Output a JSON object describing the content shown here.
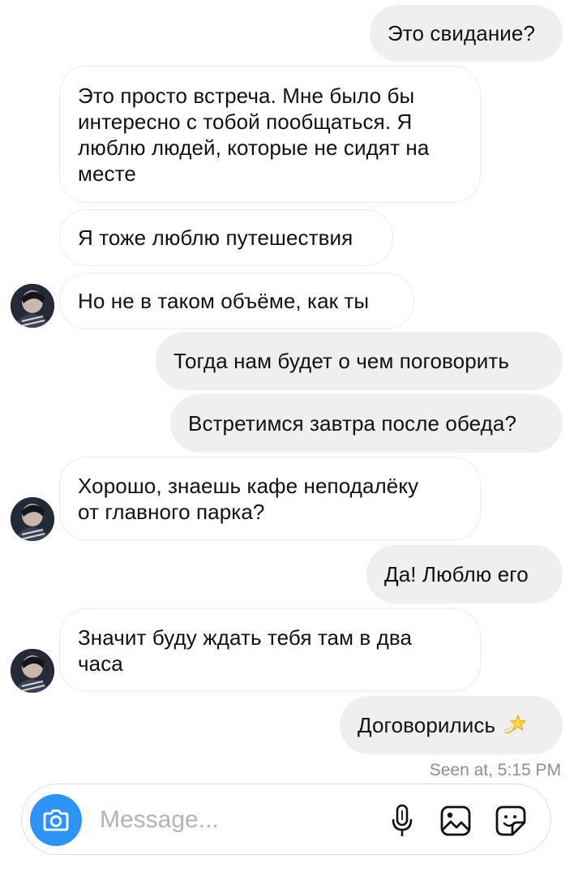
{
  "messages": [
    {
      "id": 1,
      "text": "Это свидание?",
      "direction": "outgoing"
    },
    {
      "id": 2,
      "text": "Это просто встреча. Мне было бы\nинтересно с тобой пообщаться. Я\nлюблю людей, которые не сидят на\nместе",
      "direction": "incoming"
    },
    {
      "id": 3,
      "text": "Я тоже люблю путешествия",
      "direction": "incoming"
    },
    {
      "id": 4,
      "text": "Но не в таком объёме, как ты",
      "direction": "incoming"
    },
    {
      "id": 5,
      "text": "Тогда нам будет о чем поговорить",
      "direction": "outgoing"
    },
    {
      "id": 6,
      "text": "Встретимся завтра после обеда?",
      "direction": "outgoing"
    },
    {
      "id": 7,
      "text": "Хорошо, знаешь кафе неподалёку\nот главного парка?",
      "direction": "incoming"
    },
    {
      "id": 8,
      "text": "Да! Люблю его",
      "direction": "outgoing"
    },
    {
      "id": 9,
      "text": "Значит буду ждать тебя там в два\nчаса",
      "direction": "incoming"
    },
    {
      "id": 10,
      "text": "Договорились",
      "direction": "outgoing",
      "emoji": "dizzy-star"
    }
  ],
  "seen_status": "Seen at, 5:15 PM",
  "composer": {
    "placeholder": "Message...",
    "camera_icon": "camera-icon",
    "mic_icon": "microphone-icon",
    "gallery_icon": "gallery-icon",
    "sticker_icon": "sticker-icon"
  },
  "colors": {
    "outgoing_bubble": "#efeff0",
    "incoming_border": "#ececee",
    "camera_button": "#2f93f5",
    "seen_text": "#8e8e93"
  }
}
